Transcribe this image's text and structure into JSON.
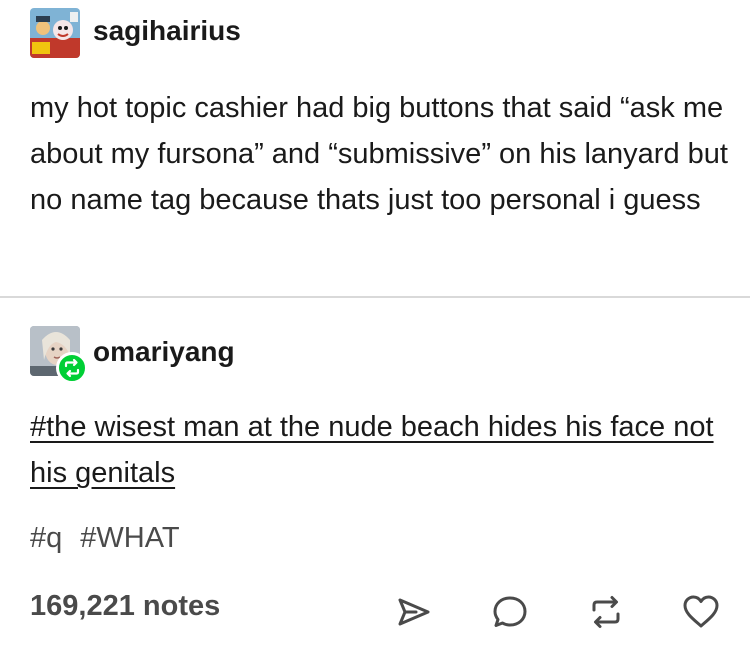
{
  "original_post": {
    "username": "sagihairius",
    "avatar_icon": "cartoon-avatar-icon",
    "body": "my hot topic cashier had big buttons that said “ask me about my fursona” and “submissive” on his lanyard but no name tag because thats just too personal i guess"
  },
  "reblog": {
    "username": "omariyang",
    "avatar_icon": "photo-avatar-icon",
    "badge_icon": "reblog-icon",
    "badge_color": "#00cf35",
    "comment": "#the wisest man at the nude beach hides his face not his genitals"
  },
  "tags": [
    "#q",
    "#WHAT"
  ],
  "footer": {
    "notes": "169,221 notes",
    "actions": [
      "share-icon",
      "reply-icon",
      "reblog-icon",
      "like-icon"
    ]
  }
}
